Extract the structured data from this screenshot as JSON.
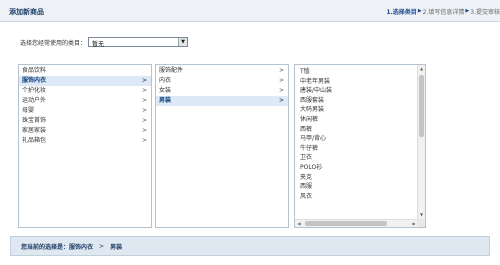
{
  "header": {
    "title": "添加新商品",
    "steps": [
      {
        "label": "1.选择类目",
        "active": true
      },
      {
        "label": "2.填写信息详情",
        "active": false
      },
      {
        "label": "3.提交审核",
        "active": false
      }
    ]
  },
  "previous": {
    "label": "选择您经常使用的类目：",
    "selected": "暂无"
  },
  "level1": {
    "items": [
      "食品饮料",
      "服饰内衣",
      "个护化妆",
      "运动户外",
      "母婴",
      "珠宝首饰",
      "家居家装",
      "礼品箱包"
    ],
    "selected_index": 1
  },
  "level2": {
    "items": [
      "服饰配件",
      "内衣",
      "女装",
      "男装"
    ],
    "selected_index": 3
  },
  "level3": {
    "items": [
      "T恤",
      "中老年男装",
      "唐装/中山装",
      "西服套装",
      "大码男装",
      "休闲裤",
      "西裤",
      "马甲/背心",
      "牛仔裤",
      "卫衣",
      "POLO衫",
      "夹克",
      "西服",
      "风衣"
    ]
  },
  "selection": {
    "label": "您当前的选择是：",
    "path": [
      "服饰内衣",
      "男装"
    ],
    "separator": ">"
  },
  "colors": {
    "accent": "#1a4c8c",
    "header_bg": "#eef2f7",
    "selected_bg": "#dde9f6",
    "bottom_bg": "#dfe7f0"
  }
}
